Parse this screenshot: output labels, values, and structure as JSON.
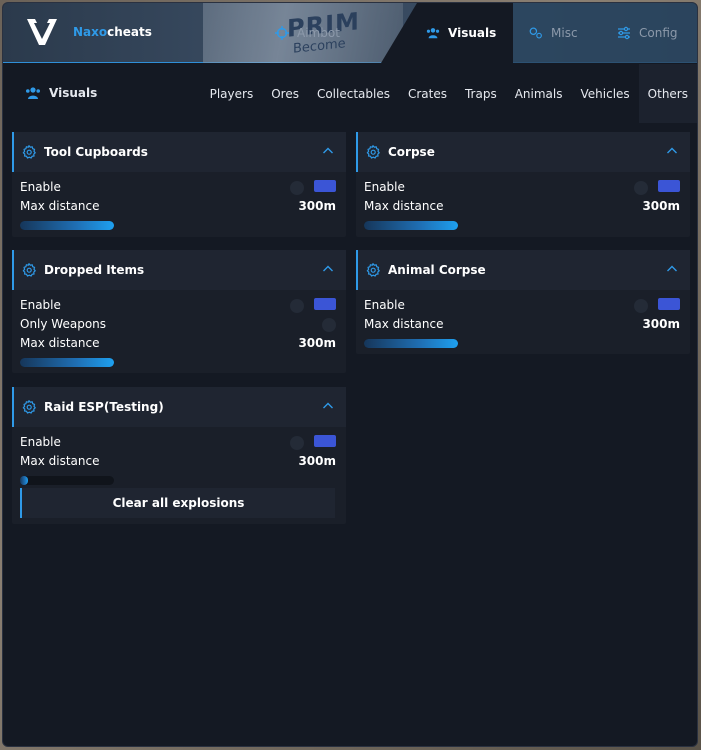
{
  "brand": {
    "part1": "Naxo",
    "part2": "cheats"
  },
  "top_tabs": [
    {
      "label": "Aimbot",
      "icon": "crosshair-icon"
    },
    {
      "label": "Visuals",
      "icon": "users-icon",
      "active": true
    },
    {
      "label": "Misc",
      "icon": "gears-icon"
    },
    {
      "label": "Config",
      "icon": "sliders-icon"
    }
  ],
  "background_text": {
    "line1": "PRIM",
    "line2": "Become"
  },
  "subnav": {
    "title": "Visuals",
    "items": [
      "Players",
      "Ores",
      "Collectables",
      "Crates",
      "Traps",
      "Animals",
      "Vehicles",
      "Others"
    ],
    "active": "Others"
  },
  "panels": {
    "tool_cupboards": {
      "title": "Tool Cupboards",
      "enable_label": "Enable",
      "enabled": true,
      "max_distance_label": "Max distance",
      "max_distance_value": "300m",
      "slider_fraction": 1.0
    },
    "corpse": {
      "title": "Corpse",
      "enable_label": "Enable",
      "enabled": true,
      "max_distance_label": "Max distance",
      "max_distance_value": "300m",
      "slider_fraction": 1.0
    },
    "dropped_items": {
      "title": "Dropped Items",
      "enable_label": "Enable",
      "enabled": true,
      "only_weapons_label": "Only Weapons",
      "only_weapons": false,
      "max_distance_label": "Max distance",
      "max_distance_value": "300m",
      "slider_fraction": 1.0
    },
    "animal_corpse": {
      "title": "Animal Corpse",
      "enable_label": "Enable",
      "enabled": true,
      "max_distance_label": "Max distance",
      "max_distance_value": "300m",
      "slider_fraction": 1.0
    },
    "raid_esp": {
      "title": "Raid ESP(Testing)",
      "enable_label": "Enable",
      "enabled": true,
      "max_distance_label": "Max distance",
      "max_distance_value": "300m",
      "slider_fraction": 0.08,
      "clear_button": "Clear all explosions"
    }
  },
  "colors": {
    "accent": "#2f9ae8",
    "toggle_on": "#3b55d6",
    "panel_bg": "#1a1f29",
    "window_bg": "#141923"
  }
}
